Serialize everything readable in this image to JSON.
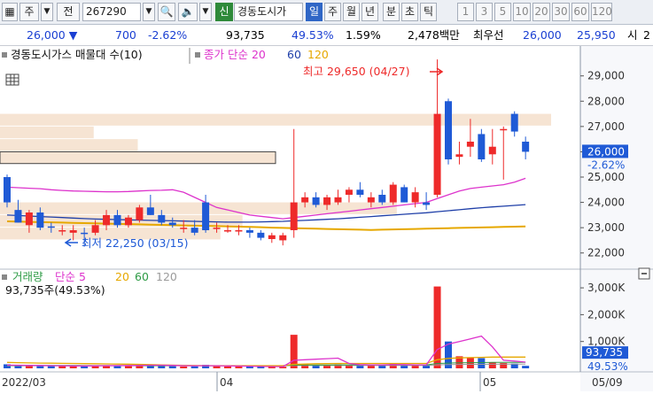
{
  "toolbar": {
    "type_select": "주",
    "prev_label": "전",
    "code": "267290",
    "new_badge": "신",
    "stock_name": "경동도시가",
    "periods": [
      "일",
      "주",
      "월",
      "년",
      "분",
      "초",
      "틱"
    ],
    "active_period": "일",
    "intervals": [
      "1",
      "3",
      "5",
      "10",
      "20",
      "30",
      "60",
      "120"
    ]
  },
  "quote": {
    "price": "26,000",
    "change": "700",
    "change_pct": "-2.62%",
    "volume": "93,735",
    "volume_ratio": "49.53%",
    "turnover": "1.59%",
    "amount": "2,478백만",
    "bid_label": "최우선",
    "ask_price": "26,000",
    "bid_price": "25,950",
    "open_label": "시",
    "open_value": "2"
  },
  "price_panel": {
    "legend_title": "경동도시가스 매물대 수(10)",
    "ma_label": "종가 단순",
    "ma_periods": [
      "20",
      "60",
      "120"
    ],
    "high_note": "최고 29,650 (04/27)",
    "low_note": "최저 22,250 (03/15)",
    "current_price_label": "26,000",
    "current_change_label": "-2.62%",
    "y_ticks": [
      "29,000",
      "28,000",
      "27,000",
      "26,000",
      "25,000",
      "24,000",
      "23,000",
      "22,000"
    ]
  },
  "volume_panel": {
    "legend_title": "거래량",
    "ma_label": "단순",
    "ma_periods": [
      "5",
      "20",
      "60",
      "120"
    ],
    "value_label": "93,735주(49.53%)",
    "current_volume_label": "93,735",
    "current_ratio_label": "49.53%",
    "y_ticks": [
      "3,000K",
      "2,000K",
      "1,000K"
    ]
  },
  "x_axis": {
    "labels": [
      "2022/03",
      "04",
      "05",
      "05/09"
    ]
  },
  "colors": {
    "up": "#ee2a2a",
    "down": "#1f5ad6",
    "ma20": "#dd33cc",
    "ma60": "#1f3fa8",
    "ma120": "#e6a800",
    "volume_profile": "#f6e4d3"
  },
  "chart_data": {
    "type": "candlestick",
    "ylim": [
      21500,
      29900
    ],
    "volume_ylim": [
      0,
      3300000
    ],
    "candles": [
      {
        "o": 25000,
        "h": 25100,
        "l": 23800,
        "c": 24000,
        "v": 150000
      },
      {
        "o": 23700,
        "h": 24100,
        "l": 23200,
        "c": 23200,
        "v": 100000
      },
      {
        "o": 23100,
        "h": 23700,
        "l": 22800,
        "c": 23600,
        "v": 120000
      },
      {
        "o": 23600,
        "h": 23800,
        "l": 22900,
        "c": 23000,
        "v": 110000
      },
      {
        "o": 23050,
        "h": 23200,
        "l": 22800,
        "c": 23000,
        "v": 90000
      },
      {
        "o": 22900,
        "h": 23100,
        "l": 22700,
        "c": 22900,
        "v": 85000
      },
      {
        "o": 22800,
        "h": 23100,
        "l": 22500,
        "c": 22900,
        "v": 80000
      },
      {
        "o": 22800,
        "h": 23000,
        "l": 22250,
        "c": 22750,
        "v": 95000
      },
      {
        "o": 22800,
        "h": 23300,
        "l": 22700,
        "c": 23100,
        "v": 100000
      },
      {
        "o": 23100,
        "h": 23700,
        "l": 22900,
        "c": 23500,
        "v": 110000
      },
      {
        "o": 23500,
        "h": 23700,
        "l": 23000,
        "c": 23100,
        "v": 95000
      },
      {
        "o": 23100,
        "h": 23500,
        "l": 23000,
        "c": 23400,
        "v": 105000
      },
      {
        "o": 23300,
        "h": 23900,
        "l": 23200,
        "c": 23800,
        "v": 120000
      },
      {
        "o": 23800,
        "h": 24300,
        "l": 23500,
        "c": 23500,
        "v": 130000
      },
      {
        "o": 23500,
        "h": 23700,
        "l": 23100,
        "c": 23200,
        "v": 110000
      },
      {
        "o": 23200,
        "h": 23400,
        "l": 23000,
        "c": 23100,
        "v": 80000
      },
      {
        "o": 23000,
        "h": 23300,
        "l": 22800,
        "c": 23000,
        "v": 70000
      },
      {
        "o": 23000,
        "h": 23300,
        "l": 22700,
        "c": 22800,
        "v": 75000
      },
      {
        "o": 24000,
        "h": 24300,
        "l": 22800,
        "c": 22900,
        "v": 130000
      },
      {
        "o": 23000,
        "h": 23200,
        "l": 22800,
        "c": 23000,
        "v": 90000
      },
      {
        "o": 22900,
        "h": 23100,
        "l": 22800,
        "c": 22900,
        "v": 70000
      },
      {
        "o": 22900,
        "h": 23100,
        "l": 22700,
        "c": 22900,
        "v": 65000
      },
      {
        "o": 22900,
        "h": 23000,
        "l": 22600,
        "c": 22800,
        "v": 65000
      },
      {
        "o": 22800,
        "h": 22900,
        "l": 22500,
        "c": 22600,
        "v": 60000
      },
      {
        "o": 22550,
        "h": 22800,
        "l": 22400,
        "c": 22700,
        "v": 60000
      },
      {
        "o": 22500,
        "h": 22800,
        "l": 22300,
        "c": 22700,
        "v": 60000
      },
      {
        "o": 22900,
        "h": 26900,
        "l": 22600,
        "c": 24000,
        "v": 1250000
      },
      {
        "o": 24000,
        "h": 24400,
        "l": 23800,
        "c": 24200,
        "v": 150000
      },
      {
        "o": 24200,
        "h": 24400,
        "l": 23800,
        "c": 23900,
        "v": 110000
      },
      {
        "o": 23900,
        "h": 24300,
        "l": 23700,
        "c": 24200,
        "v": 120000
      },
      {
        "o": 24000,
        "h": 24500,
        "l": 23900,
        "c": 24200,
        "v": 150000
      },
      {
        "o": 24300,
        "h": 24600,
        "l": 24000,
        "c": 24500,
        "v": 130000
      },
      {
        "o": 24500,
        "h": 24800,
        "l": 24200,
        "c": 24300,
        "v": 110000
      },
      {
        "o": 24000,
        "h": 24400,
        "l": 23800,
        "c": 24200,
        "v": 130000
      },
      {
        "o": 24300,
        "h": 24500,
        "l": 23900,
        "c": 24000,
        "v": 100000
      },
      {
        "o": 24000,
        "h": 24800,
        "l": 23900,
        "c": 24700,
        "v": 170000
      },
      {
        "o": 24600,
        "h": 24700,
        "l": 24000,
        "c": 24000,
        "v": 120000
      },
      {
        "o": 24000,
        "h": 24600,
        "l": 23800,
        "c": 24400,
        "v": 100000
      },
      {
        "o": 24000,
        "h": 24400,
        "l": 23700,
        "c": 23900,
        "v": 110000
      },
      {
        "o": 24300,
        "h": 29650,
        "l": 24200,
        "c": 27500,
        "v": 3050000
      },
      {
        "o": 28000,
        "h": 28100,
        "l": 25500,
        "c": 25700,
        "v": 1000000
      },
      {
        "o": 25800,
        "h": 26400,
        "l": 25500,
        "c": 25900,
        "v": 450000
      },
      {
        "o": 26200,
        "h": 27300,
        "l": 25800,
        "c": 26400,
        "v": 400000
      },
      {
        "o": 26700,
        "h": 26900,
        "l": 25600,
        "c": 25700,
        "v": 380000
      },
      {
        "o": 25900,
        "h": 26900,
        "l": 25500,
        "c": 26200,
        "v": 230000
      },
      {
        "o": 26900,
        "h": 27000,
        "l": 24900,
        "c": 26900,
        "v": 200000
      },
      {
        "o": 27500,
        "h": 27600,
        "l": 26600,
        "c": 26800,
        "v": 180000
      },
      {
        "o": 26400,
        "h": 26600,
        "l": 25700,
        "c": 26000,
        "v": 93735
      }
    ],
    "ma20": [
      24600,
      24580,
      24560,
      24540,
      24500,
      24470,
      24450,
      24440,
      24430,
      24420,
      24420,
      24430,
      24450,
      24470,
      24480,
      24500,
      24400,
      24200,
      24000,
      23800,
      23700,
      23600,
      23500,
      23450,
      23400,
      23350,
      23400,
      23450,
      23500,
      23550,
      23600,
      23650,
      23700,
      23750,
      23800,
      23850,
      23900,
      23950,
      24000,
      24150,
      24300,
      24450,
      24550,
      24600,
      24650,
      24700,
      24800,
      24950
    ],
    "ma60": [
      23500,
      23480,
      23460,
      23440,
      23420,
      23400,
      23380,
      23360,
      23340,
      23330,
      23320,
      23310,
      23300,
      23290,
      23280,
      23270,
      23260,
      23250,
      23240,
      23230,
      23220,
      23220,
      23220,
      23230,
      23240,
      23250,
      23270,
      23290,
      23310,
      23330,
      23350,
      23380,
      23410,
      23440,
      23470,
      23500,
      23530,
      23560,
      23590,
      23630,
      23670,
      23710,
      23750,
      23790,
      23820,
      23850,
      23880,
      23910
    ],
    "ma120": [
      23250,
      23240,
      23230,
      23220,
      23210,
      23200,
      23190,
      23180,
      23170,
      23160,
      23150,
      23140,
      23130,
      23120,
      23110,
      23100,
      23090,
      23080,
      23070,
      23060,
      23050,
      23040,
      23030,
      23020,
      23000,
      22990,
      22980,
      22970,
      22960,
      22950,
      22940,
      22930,
      22920,
      22910,
      22920,
      22930,
      22940,
      22950,
      22960,
      22970,
      22980,
      22990,
      23000,
      23010,
      23020,
      23030,
      23040,
      23050
    ],
    "vol_ma5": [
      120000,
      115000,
      110000,
      105000,
      100000,
      95000,
      90000,
      88000,
      92000,
      100000,
      103000,
      105000,
      110000,
      115000,
      115000,
      110000,
      100000,
      95000,
      100000,
      95000,
      90000,
      85000,
      80000,
      70000,
      65000,
      62000,
      300000,
      320000,
      340000,
      360000,
      380000,
      180000,
      140000,
      130000,
      130000,
      140000,
      140000,
      130000,
      130000,
      700000,
      900000,
      1000000,
      1100000,
      1200000,
      800000,
      300000,
      270000,
      230000
    ],
    "vol_ma20": [
      220000,
      210000,
      200000,
      195000,
      190000,
      185000,
      180000,
      175000,
      170000,
      165000,
      160000,
      155000,
      150000,
      140000,
      130000,
      120000,
      110000,
      105000,
      100000,
      100000,
      100000,
      100000,
      100000,
      100000,
      100000,
      100000,
      150000,
      160000,
      170000,
      175000,
      180000,
      180000,
      180000,
      180000,
      180000,
      180000,
      180000,
      180000,
      180000,
      320000,
      370000,
      390000,
      400000,
      410000,
      420000,
      420000,
      420000,
      420000
    ],
    "vol_ma60": [
      110000,
      109000,
      108000,
      107000,
      106000,
      105000,
      104000,
      103000,
      102000,
      101000,
      100000,
      100000,
      100000,
      100000,
      100000,
      100000,
      100000,
      100000,
      100000,
      100000,
      100000,
      100000,
      100000,
      100000,
      100000,
      100000,
      120000,
      122000,
      124000,
      126000,
      128000,
      130000,
      130000,
      130000,
      130000,
      130000,
      130000,
      130000,
      130000,
      180000,
      195000,
      205000,
      210000,
      215000,
      220000,
      222000,
      224000,
      226000
    ],
    "vol_ma120": [
      95000,
      95000,
      95000,
      95000,
      95000,
      95000,
      95000,
      95000,
      95000,
      95000,
      95000,
      95000,
      95000,
      95000,
      95000,
      95000,
      95000,
      95000,
      95000,
      95000,
      95000,
      95000,
      95000,
      95000,
      95000,
      95000,
      105000,
      106000,
      107000,
      108000,
      109000,
      110000,
      110000,
      110000,
      110000,
      110000,
      110000,
      110000,
      110000,
      130000,
      138000,
      144000,
      148000,
      150000,
      152000,
      154000,
      156000,
      158000
    ],
    "volume_profile": [
      {
        "low": 27000,
        "high": 27500,
        "rel": 1.0
      },
      {
        "low": 26500,
        "high": 27000,
        "rel": 0.17
      },
      {
        "low": 26000,
        "high": 26500,
        "rel": 0.25
      },
      {
        "low": 25500,
        "high": 26000,
        "rel": 0.5
      },
      {
        "low": 23500,
        "high": 24000,
        "rel": 0.72
      },
      {
        "low": 23000,
        "high": 23500,
        "rel": 0.44
      },
      {
        "low": 22500,
        "high": 23000,
        "rel": 0.4
      }
    ]
  }
}
